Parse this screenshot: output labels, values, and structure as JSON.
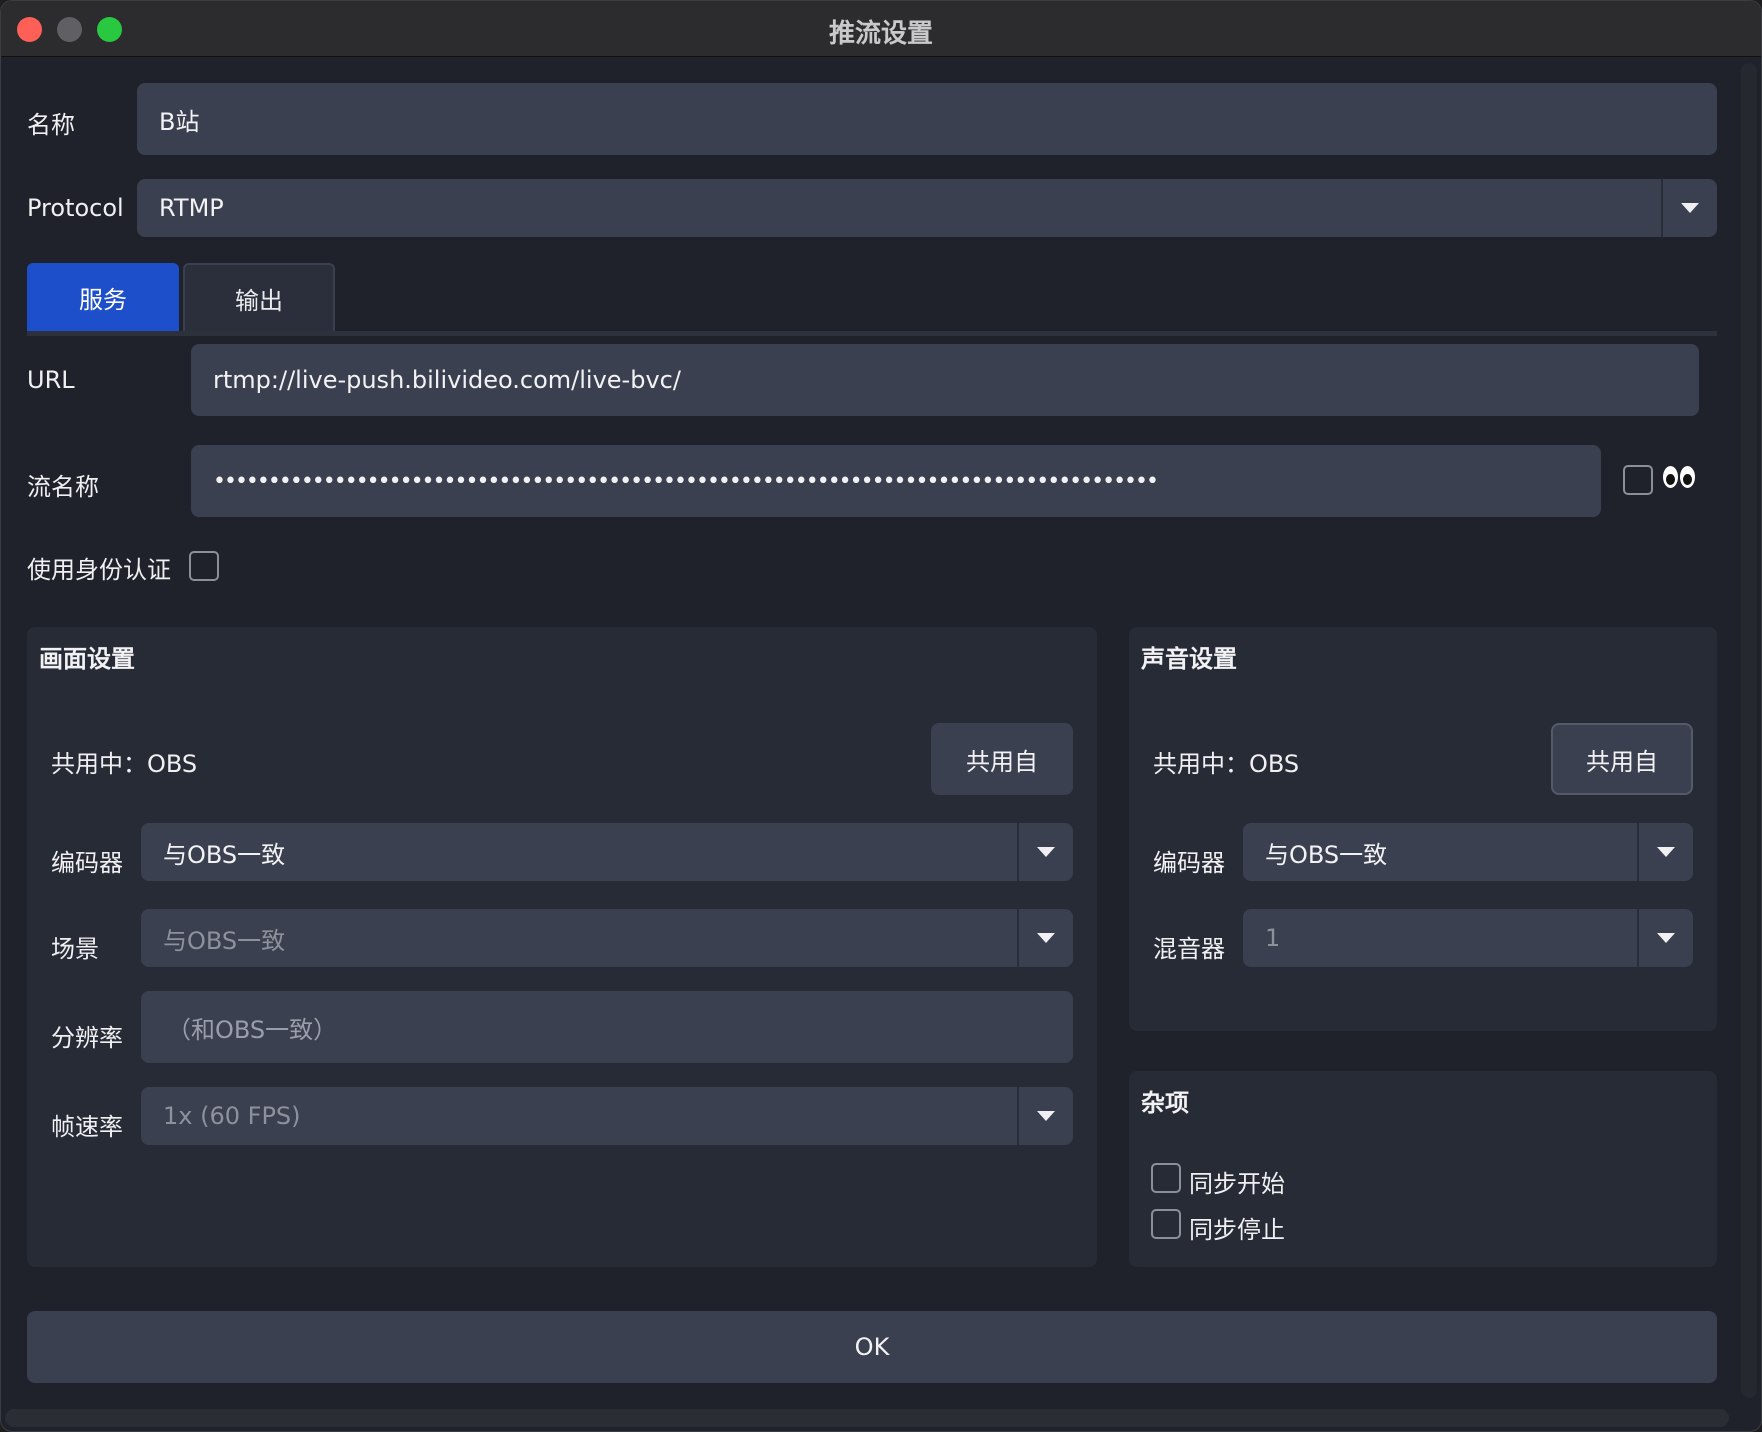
{
  "window": {
    "title": "推流设置"
  },
  "form": {
    "name_label": "名称",
    "name_value": "B站",
    "protocol_label": "Protocol",
    "protocol_value": "RTMP"
  },
  "tabs": [
    {
      "label": "服务",
      "active": true
    },
    {
      "label": "输出",
      "active": false
    }
  ],
  "service": {
    "url_label": "URL",
    "url_value": "rtmp://live-push.bilivideo.com/live-bvc/",
    "key_label": "流名称",
    "key_value": "••••••••••••••••••••••••••••••••••••••••••••••••••••••••••••••••••••••••••••••••••••••",
    "auth_label": "使用身份认证"
  },
  "video": {
    "title": "画面设置",
    "shared_text": "共用中：OBS",
    "share_button": "共用自",
    "encoder_label": "编码器",
    "encoder_value": "与OBS一致",
    "scene_label": "场景",
    "scene_value": "与OBS一致",
    "resolution_label": "分辨率",
    "resolution_placeholder": "（和OBS一致）",
    "fps_label": "帧速率",
    "fps_value": "1x (60 FPS)"
  },
  "audio": {
    "title": "声音设置",
    "shared_text": "共用中：OBS",
    "share_button": "共用自",
    "encoder_label": "编码器",
    "encoder_value": "与OBS一致",
    "mixer_label": "混音器",
    "mixer_value": "1"
  },
  "misc": {
    "title": "杂项",
    "sync_start_label": "同步开始",
    "sync_stop_label": "同步停止"
  },
  "ok_button": "OK",
  "colors": {
    "accent": "#1c4fc9",
    "window_bg": "#1f222b",
    "field_bg": "#3b4050",
    "panel_bg": "#272b36"
  }
}
